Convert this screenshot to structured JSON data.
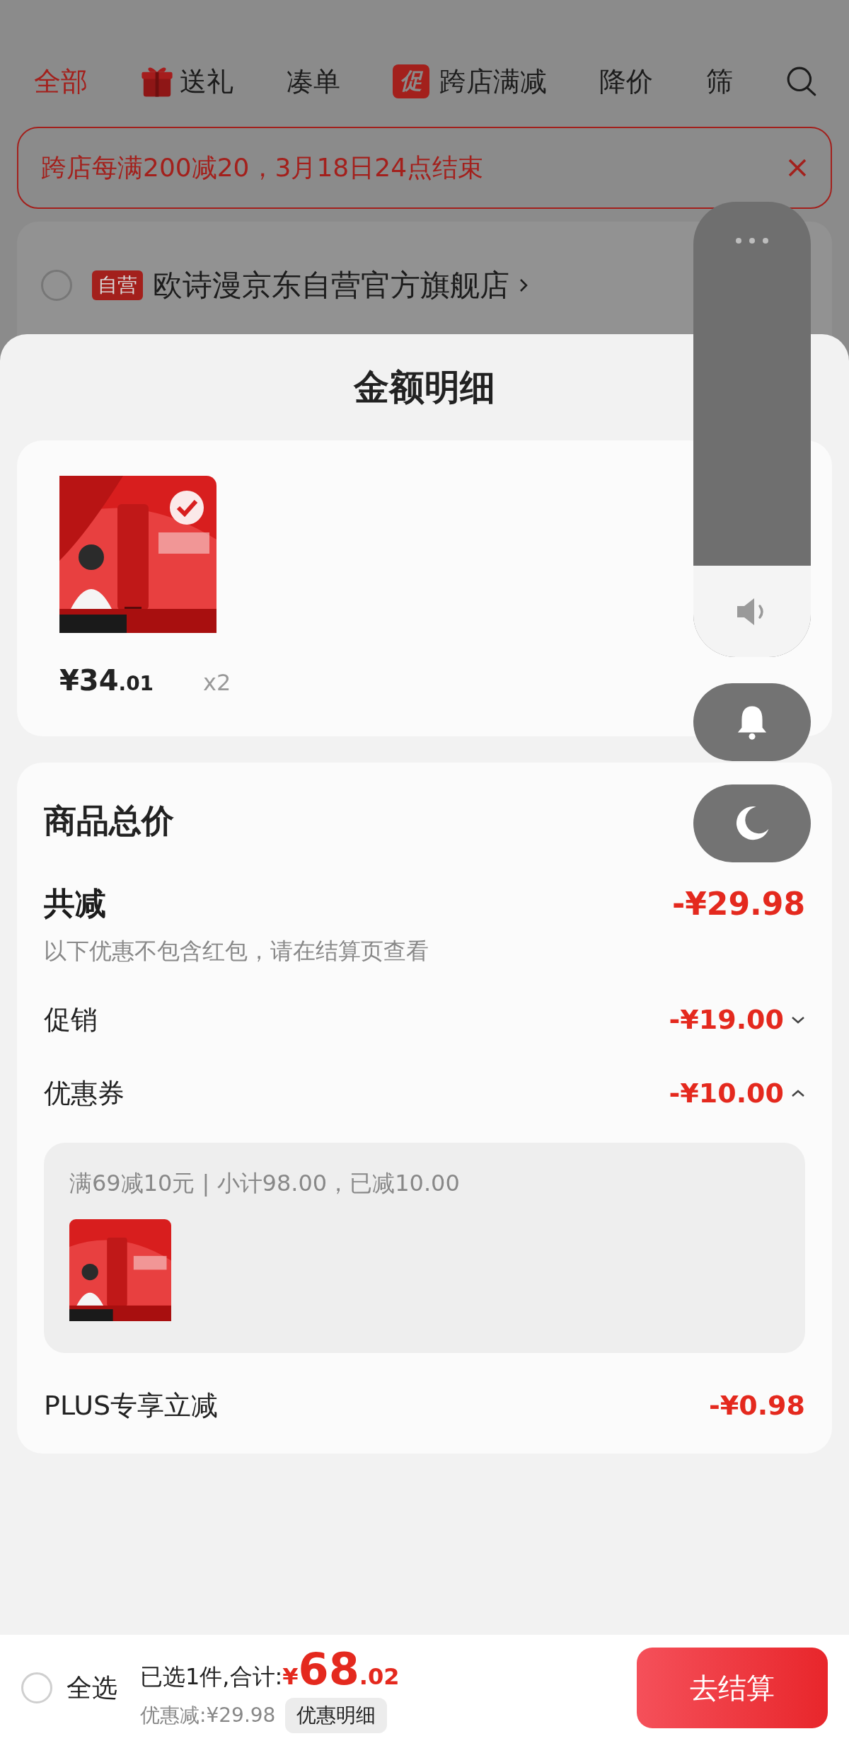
{
  "filter_tabs": [
    {
      "label": "全部",
      "selected": true,
      "kind": "text"
    },
    {
      "label": "送礼",
      "selected": false,
      "kind": "gift"
    },
    {
      "label": "凑单",
      "selected": false,
      "kind": "text"
    },
    {
      "label": "跨店满减",
      "selected": false,
      "kind": "promo",
      "badge": "促"
    },
    {
      "label": "降价",
      "selected": false,
      "kind": "text"
    },
    {
      "label": "筛",
      "selected": false,
      "kind": "text"
    }
  ],
  "promo_banner": {
    "text": "跨店每满200减20，3月18日24点结束"
  },
  "store": {
    "checked": false,
    "badge": "自营",
    "name": "欧诗漫京东自营官方旗舰店"
  },
  "sheet": {
    "title": "金额明细",
    "product": {
      "price_main": "¥34",
      "price_decimal": ".01",
      "quantity": "x2"
    },
    "total_label": "商品总价",
    "discount": {
      "label": "共减",
      "amount": "-¥29.98",
      "note": "以下优惠不包含红包，请在结算页查看"
    },
    "rows": [
      {
        "kind": "expandable",
        "label": "促销",
        "amount": "-¥19.00",
        "expanded": false
      },
      {
        "kind": "expandable",
        "label": "优惠券",
        "amount": "-¥10.00",
        "expanded": true,
        "detail": "满69减10元 | 小计98.00，已减10.00"
      },
      {
        "kind": "plain",
        "label": "PLUS专享立减",
        "amount": "-¥0.98"
      }
    ]
  },
  "bottom_bar": {
    "select_all": {
      "label": "全选",
      "checked": false
    },
    "summary": "已选1件,合计:",
    "total_symbol": "¥",
    "total_main": "68",
    "total_decimal": ".02",
    "saved": "优惠减:¥29.98",
    "detail_button": "优惠明细",
    "checkout": "去结算"
  },
  "volume": {
    "level": 0.2
  }
}
